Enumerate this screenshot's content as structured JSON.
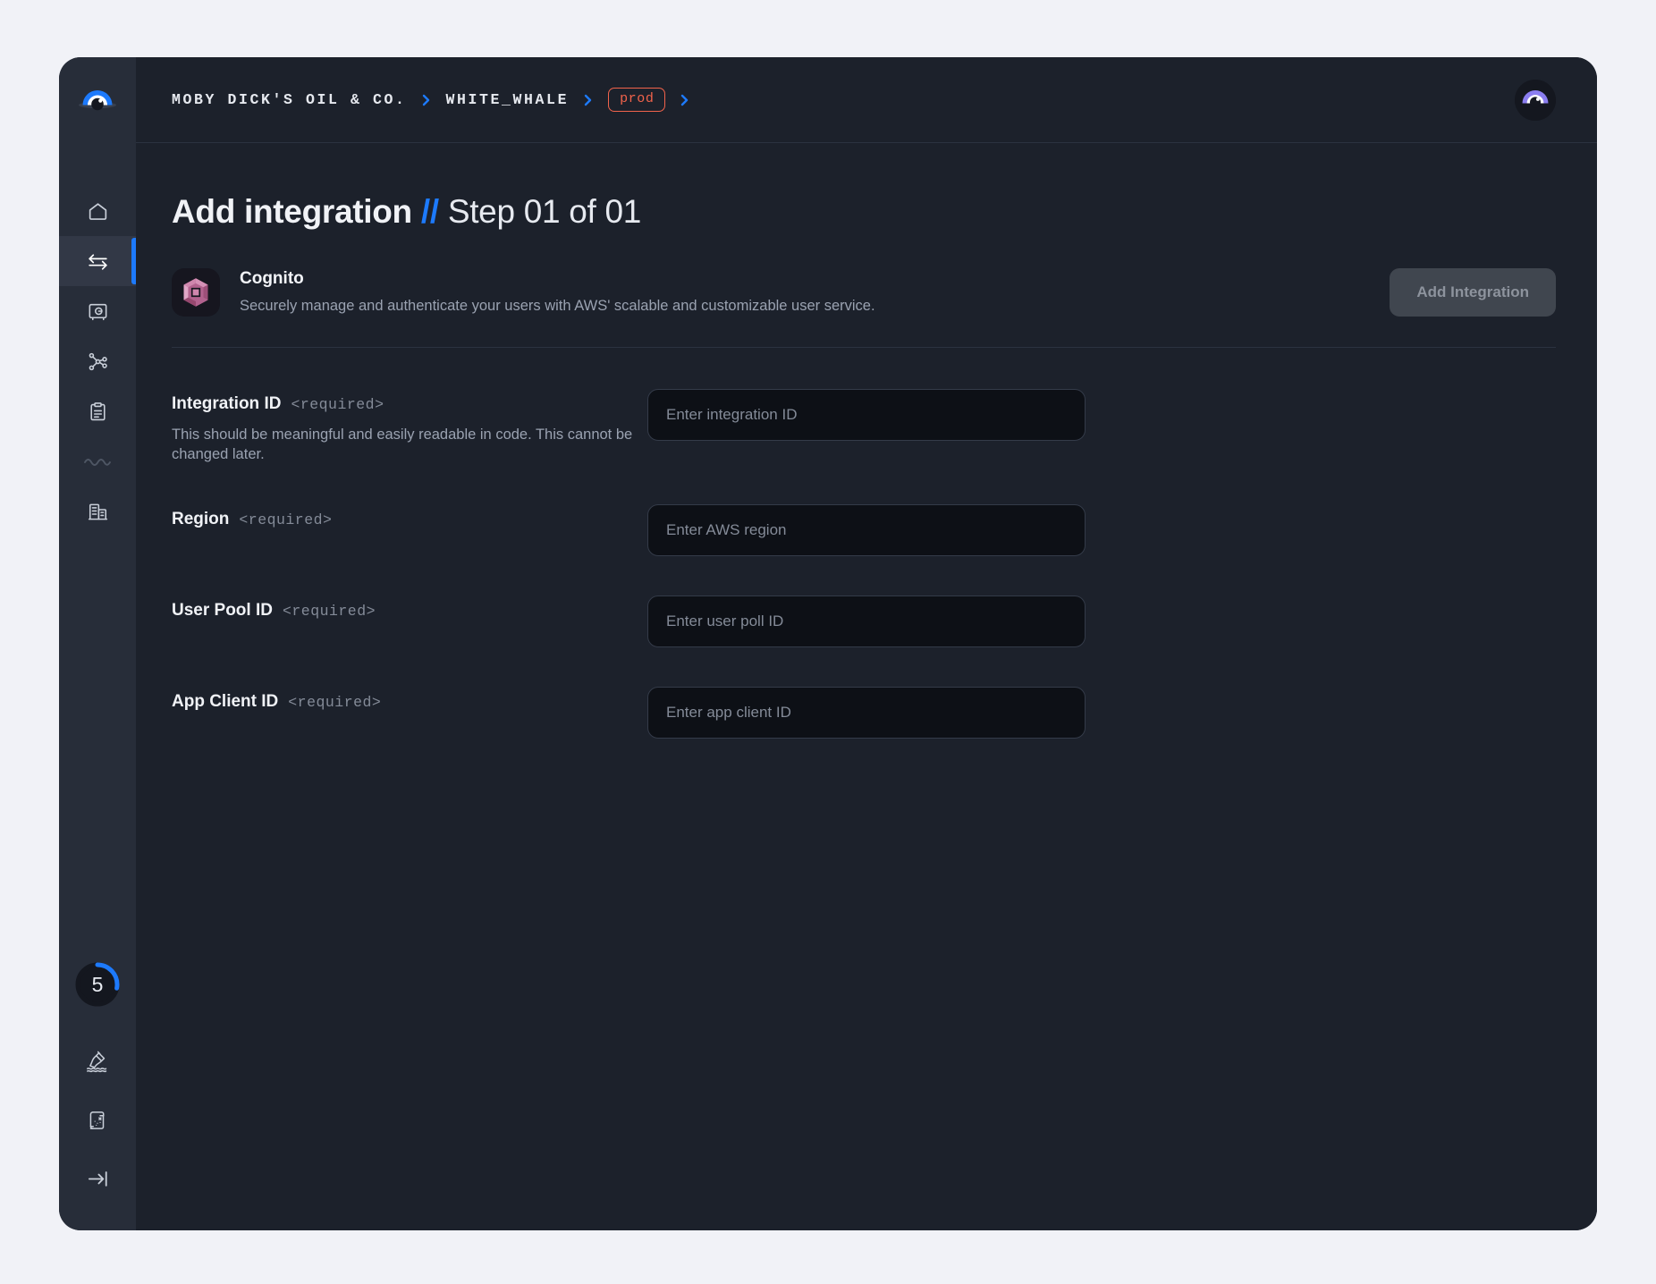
{
  "breadcrumb": {
    "items": [
      {
        "label": "MOBY DICK'S OIL & CO.",
        "type": "text"
      },
      {
        "label": "WHITE_WHALE",
        "type": "text"
      }
    ],
    "env_badge": "prod"
  },
  "sidebar": {
    "logo_name": "whale-eye-logo",
    "items": [
      {
        "name": "home",
        "icon": "home-icon",
        "active": false
      },
      {
        "name": "integrations",
        "icon": "exchange-arrows-icon",
        "active": true
      },
      {
        "name": "vault",
        "icon": "safe-icon",
        "active": false
      },
      {
        "name": "network",
        "icon": "network-nodes-icon",
        "active": false
      },
      {
        "name": "logs",
        "icon": "clipboard-icon",
        "active": false
      },
      {
        "name": "waves",
        "icon": "waves-icon",
        "active": false
      },
      {
        "name": "organization",
        "icon": "building-icon",
        "active": false
      }
    ],
    "progress": {
      "value": "5",
      "percent": 28,
      "track_color": "#14171f",
      "arc_color": "#1d7afc"
    },
    "bottom_items": [
      {
        "name": "message-in-a-bottle",
        "icon": "bottle-icon"
      },
      {
        "name": "treasure-map",
        "icon": "scroll-map-icon"
      },
      {
        "name": "collapse-sidebar",
        "icon": "arrow-to-line-icon"
      }
    ]
  },
  "header": {
    "title": "Add integration",
    "separator": "//",
    "step": "Step 01 of 01"
  },
  "integration": {
    "icon_name": "aws-cognito-icon",
    "name": "Cognito",
    "description": "Securely manage and authenticate your users with AWS' scalable and customizable user service.",
    "action_label": "Add Integration"
  },
  "form": {
    "fields": [
      {
        "label": "Integration ID",
        "required_tag": "<required>",
        "help": "This should be meaningful and easily readable in code. This cannot be changed later.",
        "placeholder": "Enter integration ID",
        "value": ""
      },
      {
        "label": "Region",
        "required_tag": "<required>",
        "help": "",
        "placeholder": "Enter AWS region",
        "value": ""
      },
      {
        "label": "User Pool ID",
        "required_tag": "<required>",
        "help": "",
        "placeholder": "Enter user poll ID",
        "value": ""
      },
      {
        "label": "App Client ID",
        "required_tag": "<required>",
        "help": "",
        "placeholder": "Enter app client ID",
        "value": ""
      }
    ]
  },
  "colors": {
    "page_background": "#f1f2f7",
    "window_background": "#1c212b",
    "sidebar_background": "#272d39",
    "accent_blue": "#1d7afc",
    "env_red": "#f2634b",
    "cognito_pink": "#c770a0"
  }
}
